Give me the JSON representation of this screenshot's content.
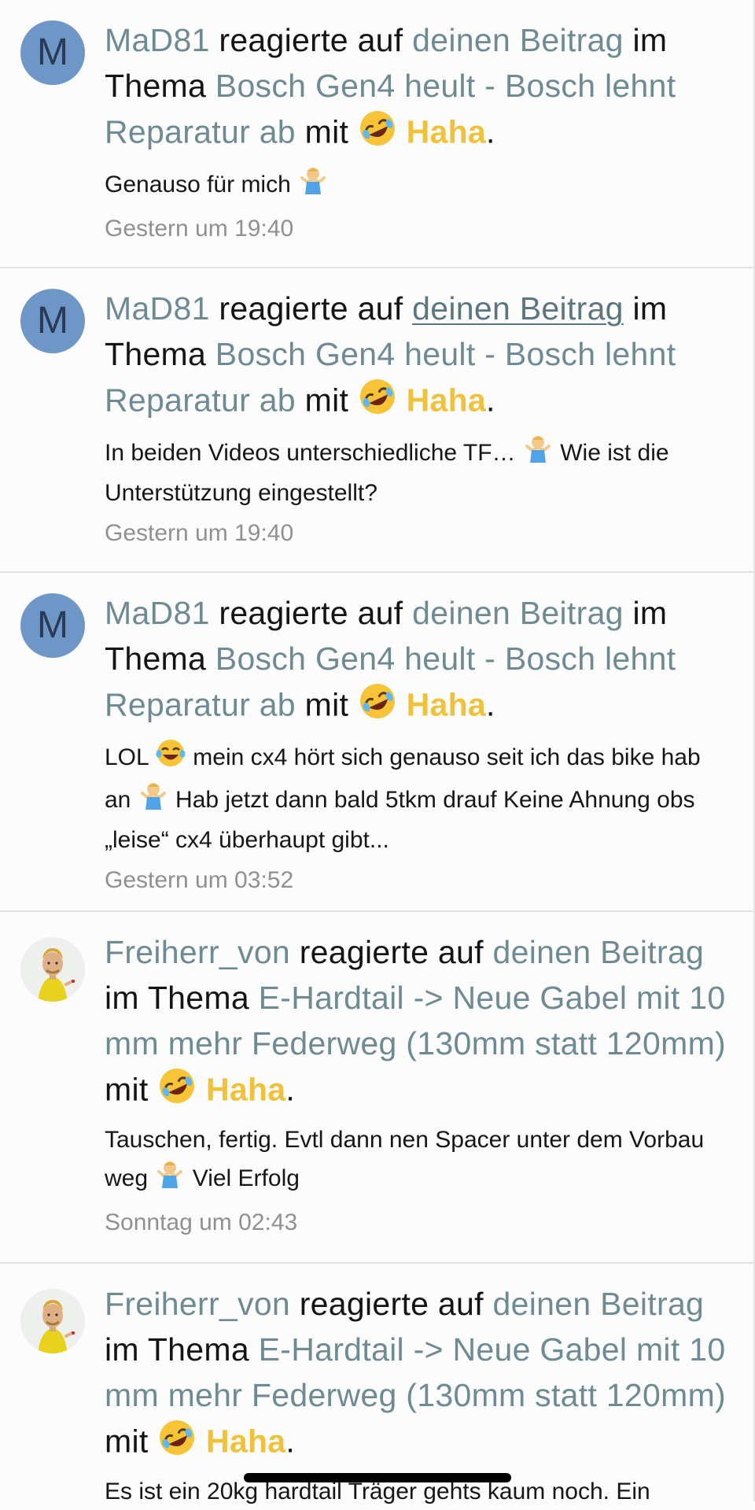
{
  "alerts": [
    {
      "avatar_letter": "M",
      "user": "MaD81",
      "action": " reagierte auf ",
      "post_link": "deinen Beitrag",
      "in_thread": " im Thema ",
      "thread": "Bosch Gen4 heult - Bosch lehnt Reparatur ab",
      "with": " mit ",
      "reaction": "Haha",
      "snippet_a": "Genauso für mich",
      "snippet_b": "",
      "time": "Gestern um 19:40"
    },
    {
      "avatar_letter": "M",
      "user": "MaD81",
      "action": " reagierte auf ",
      "post_link": "deinen Beitrag",
      "in_thread": " im Thema ",
      "thread": "Bosch Gen4 heult - Bosch lehnt Reparatur ab",
      "with": " mit ",
      "reaction": "Haha",
      "snippet_a": "In beiden Videos unterschiedliche TF…",
      "snippet_b": " Wie ist die Unterstützung eingestellt?",
      "time": "Gestern um 19:40"
    },
    {
      "avatar_letter": "M",
      "user": "MaD81",
      "action": " reagierte auf ",
      "post_link": "deinen Beitrag",
      "in_thread": " im Thema ",
      "thread": "Bosch Gen4 heult - Bosch lehnt Reparatur ab",
      "with": " mit ",
      "reaction": "Haha",
      "snippet_a": "LOL",
      "snippet_b": " mein cx4 hört sich genauso seit ich das bike hab an",
      "snippet_c": " Hab jetzt dann bald 5tkm drauf Keine Ahnung obs „leise“ cx4 überhaupt gibt...",
      "time": "Gestern um 03:52"
    },
    {
      "user": "Freiherr_von",
      "action": " reagierte auf ",
      "post_link": "deinen Beitrag",
      "in_thread": " im Thema ",
      "thread": "E-Hardtail -> Neue Gabel mit 10 mm mehr Federweg (130mm statt 120mm)",
      "with": " mit ",
      "reaction": "Haha",
      "snippet_a": "Tauschen, fertig. Evtl dann nen Spacer unter dem Vorbau weg",
      "snippet_b": " Viel Erfolg",
      "time": "Sonntag um 02:43"
    },
    {
      "user": "Freiherr_von",
      "action": " reagierte auf ",
      "post_link": "deinen Beitrag",
      "in_thread": " im Thema ",
      "thread": "E-Hardtail -> Neue Gabel mit 10 mm mehr Federweg (130mm statt 120mm)",
      "with": " mit ",
      "reaction": "Haha",
      "snippet_a": "Es ist ein 20kg hardtail Träger gehts kaum noch. Ein"
    }
  ],
  "period": ".",
  "icons": {
    "reaction": "rolling-on-floor-laughing-icon",
    "shrug": "person-shrugging-icon",
    "tears": "tears-of-joy-icon"
  },
  "colors": {
    "link": "#6e8a93",
    "haha": "#f0c23c",
    "avatar_bg": "#6e97c8",
    "time": "#909090"
  }
}
